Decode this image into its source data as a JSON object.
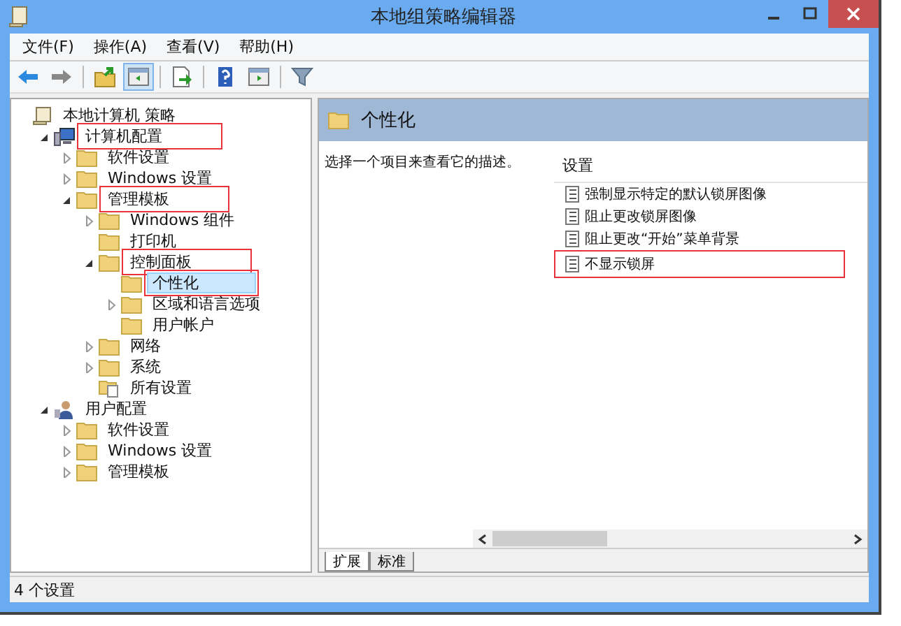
{
  "window": {
    "title": "本地组策略编辑器"
  },
  "menu": [
    "文件(F)",
    "操作(A)",
    "查看(V)",
    "帮助(H)"
  ],
  "toolbar": [
    {
      "kind": "back"
    },
    {
      "kind": "forward"
    },
    {
      "kind": "sep"
    },
    {
      "kind": "up"
    },
    {
      "kind": "panes",
      "selected": true
    },
    {
      "kind": "sep"
    },
    {
      "kind": "export",
      "selected": false
    },
    {
      "kind": "sep"
    },
    {
      "kind": "help",
      "selected": false
    },
    {
      "kind": "view",
      "selected": false
    },
    {
      "kind": "sep"
    },
    {
      "kind": "filter",
      "selected": false
    }
  ],
  "tree": [
    {
      "label": "本地计算机 策略",
      "kind": "scroll",
      "selected": false,
      "annotated": false,
      "children": [
        {
          "label": "计算机配置",
          "kind": "computer",
          "expanded": true,
          "selected": false,
          "annotated": true,
          "children": [
            {
              "label": "软件设置",
              "kind": "folder",
              "expanded": false,
              "selected": false,
              "annotated": false
            },
            {
              "label": "Windows 设置",
              "kind": "folder",
              "expanded": false,
              "selected": false,
              "annotated": false
            },
            {
              "label": "管理模板",
              "kind": "folder",
              "expanded": true,
              "selected": false,
              "annotated": true,
              "children": [
                {
                  "label": "Windows 组件",
                  "kind": "folder",
                  "expanded": false,
                  "selected": false,
                  "annotated": false
                },
                {
                  "label": "打印机",
                  "kind": "folder",
                  "selected": false,
                  "annotated": false
                },
                {
                  "label": "控制面板",
                  "kind": "folder",
                  "expanded": true,
                  "selected": false,
                  "annotated": true,
                  "children": [
                    {
                      "label": "个性化",
                      "kind": "folder",
                      "selected": true,
                      "annotated": true
                    },
                    {
                      "label": "区域和语言选项",
                      "kind": "folder",
                      "expanded": false,
                      "selected": false,
                      "annotated": false
                    },
                    {
                      "label": "用户帐户",
                      "kind": "folder",
                      "selected": false,
                      "annotated": false
                    }
                  ]
                },
                {
                  "label": "网络",
                  "kind": "folder",
                  "expanded": false,
                  "selected": false,
                  "annotated": false
                },
                {
                  "label": "系统",
                  "kind": "folder",
                  "expanded": false,
                  "selected": false,
                  "annotated": false
                },
                {
                  "label": "所有设置",
                  "kind": "settings",
                  "selected": false,
                  "annotated": false
                }
              ]
            }
          ]
        },
        {
          "label": "用户配置",
          "kind": "user",
          "expanded": true,
          "selected": false,
          "annotated": false,
          "children": [
            {
              "label": "软件设置",
              "kind": "folder",
              "expanded": false,
              "selected": false,
              "annotated": false
            },
            {
              "label": "Windows 设置",
              "kind": "folder",
              "expanded": false,
              "selected": false,
              "annotated": false
            },
            {
              "label": "管理模板",
              "kind": "folder",
              "expanded": false,
              "selected": false,
              "annotated": false
            }
          ]
        }
      ]
    }
  ],
  "detail": {
    "title": "个性化",
    "description": "选择一个项目来查看它的描述。",
    "column": "设置",
    "settings": [
      {
        "label": "强制显示特定的默认锁屏图像",
        "annotated": false
      },
      {
        "label": "阻止更改锁屏图像",
        "annotated": false
      },
      {
        "label": "阻止更改“开始”菜单背景",
        "annotated": false
      },
      {
        "label": "不显示锁屏",
        "annotated": true
      }
    ],
    "tabs": [
      {
        "label": "扩展",
        "selected": true
      },
      {
        "label": "标准",
        "selected": false
      }
    ]
  },
  "status_bar": "4 个设置"
}
